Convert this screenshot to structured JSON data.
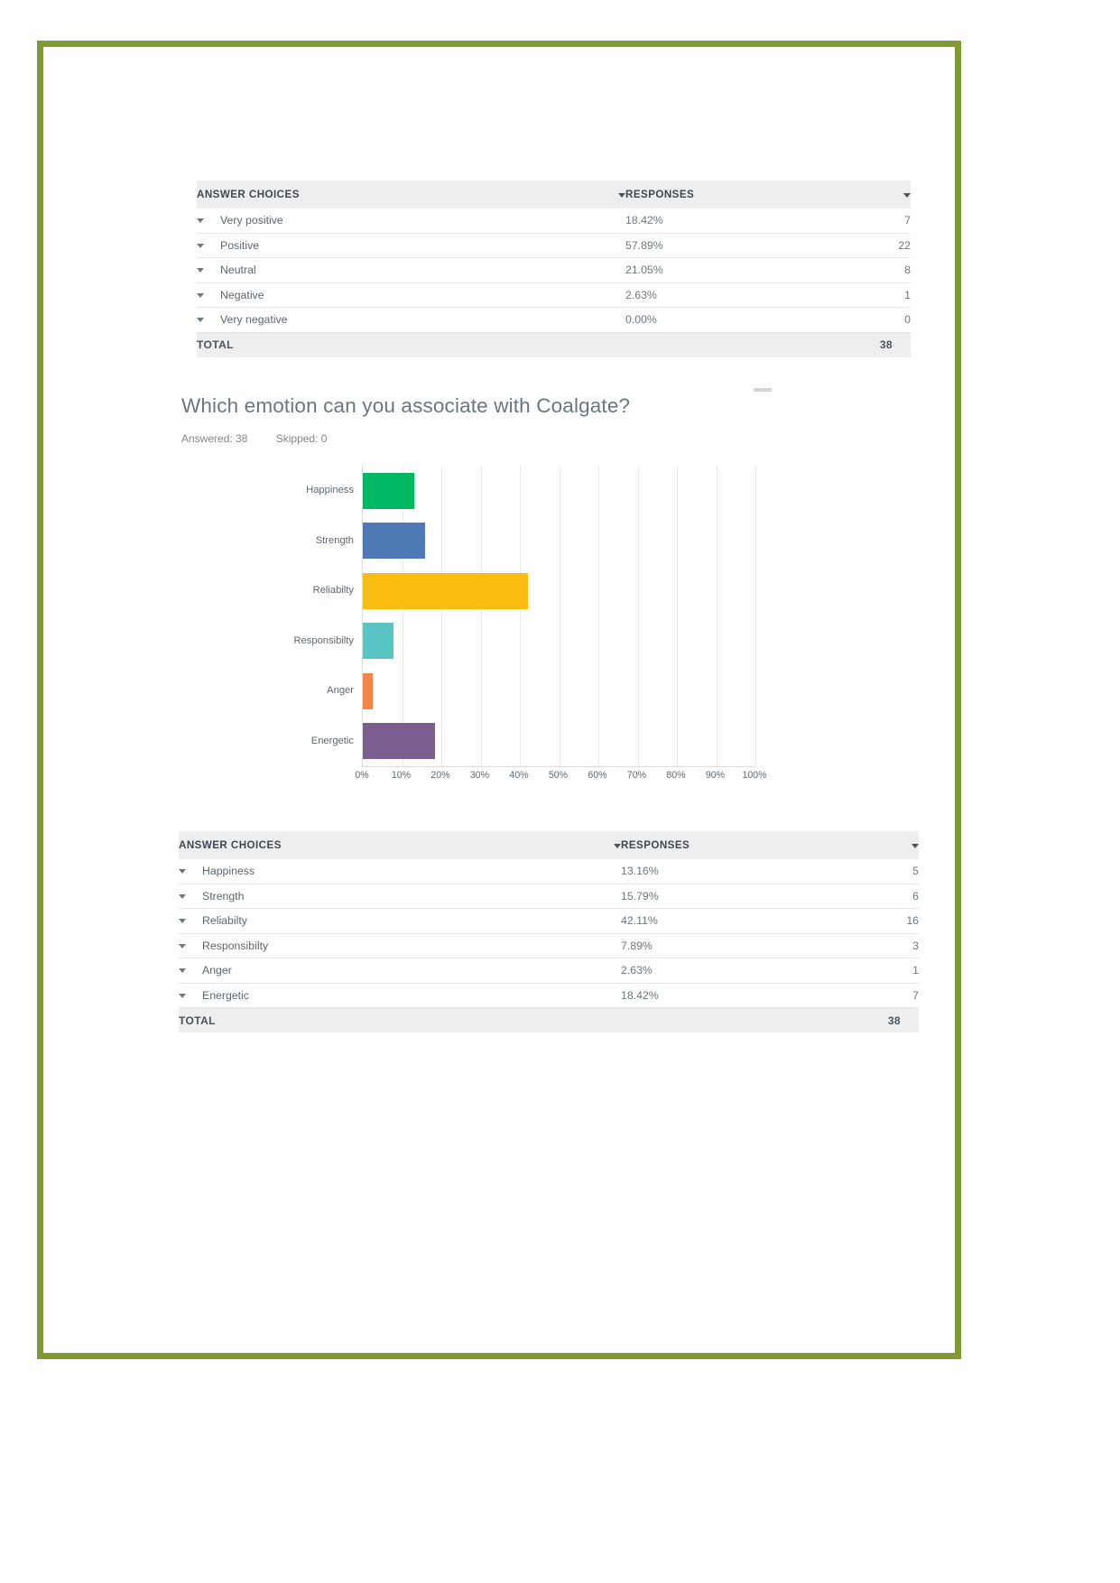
{
  "page": {
    "border_color": "#7f9b33",
    "background": "#ffffff"
  },
  "table_sentiment": {
    "columns": [
      "ANSWER CHOICES",
      "RESPONSES"
    ],
    "rows": [
      {
        "label": "Very positive",
        "percent": "18.42%",
        "count": "7"
      },
      {
        "label": "Positive",
        "percent": "57.89%",
        "count": "22"
      },
      {
        "label": "Neutral",
        "percent": "21.05%",
        "count": "8"
      },
      {
        "label": "Negative",
        "percent": "2.63%",
        "count": "1"
      },
      {
        "label": "Very negative",
        "percent": "0.00%",
        "count": "0"
      }
    ],
    "total_label": "TOTAL",
    "total_value": "38"
  },
  "question": {
    "title": "Which emotion can you associate with Coalgate?",
    "answered_label": "Answered: 38",
    "skipped_label": "Skipped: 0"
  },
  "chart_data": {
    "type": "bar",
    "orientation": "horizontal",
    "title": "Which emotion can you associate with Coalgate?",
    "xlabel": "",
    "ylabel": "",
    "xlim": [
      0,
      100
    ],
    "grid": true,
    "legend": "none",
    "categories": [
      "Happiness",
      "Strength",
      "Reliabilty",
      "Responsibilty",
      "Anger",
      "Energetic"
    ],
    "values": [
      13.16,
      15.79,
      42.11,
      7.89,
      2.63,
      18.42
    ],
    "counts": [
      5,
      6,
      16,
      3,
      1,
      7
    ],
    "colors": [
      "#00b863",
      "#4e79b4",
      "#f9bc11",
      "#5bc4c4",
      "#f4854b",
      "#7b5e8f"
    ],
    "xticks": [
      "0%",
      "10%",
      "20%",
      "30%",
      "40%",
      "50%",
      "60%",
      "70%",
      "80%",
      "90%",
      "100%"
    ],
    "xtick_values": [
      0,
      10,
      20,
      30,
      40,
      50,
      60,
      70,
      80,
      90,
      100
    ]
  },
  "table_emotion": {
    "columns": [
      "ANSWER CHOICES",
      "RESPONSES"
    ],
    "rows": [
      {
        "label": "Happiness",
        "percent": "13.16%",
        "count": "5"
      },
      {
        "label": "Strength",
        "percent": "15.79%",
        "count": "6"
      },
      {
        "label": "Reliabilty",
        "percent": "42.11%",
        "count": "16"
      },
      {
        "label": "Responsibilty",
        "percent": "7.89%",
        "count": "3"
      },
      {
        "label": "Anger",
        "percent": "2.63%",
        "count": "1"
      },
      {
        "label": "Energetic",
        "percent": "18.42%",
        "count": "7"
      }
    ],
    "total_label": "TOTAL",
    "total_value": "38"
  }
}
